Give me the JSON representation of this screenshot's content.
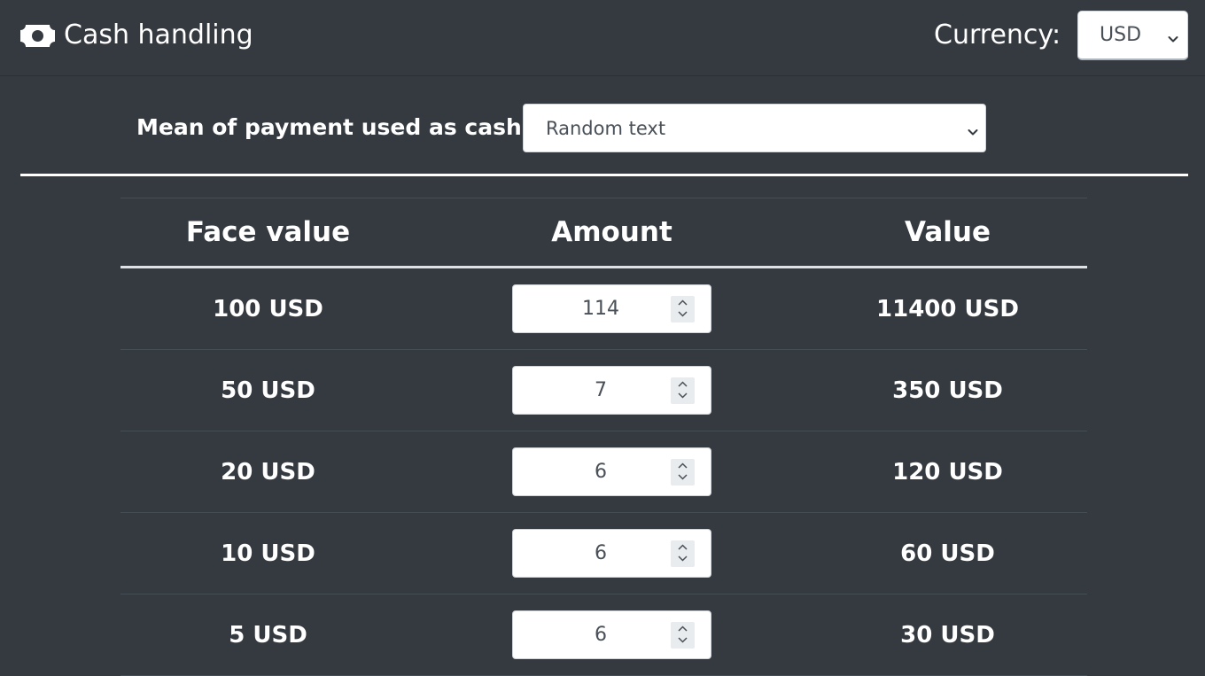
{
  "header": {
    "title": "Cash handling",
    "icon": "money-bill-icon",
    "currency_label": "Currency:",
    "currency_selected": "USD"
  },
  "payment": {
    "label": "Mean of payment used as cash:",
    "selected": "Random text"
  },
  "table": {
    "columns": [
      "Face value",
      "Amount",
      "Value"
    ],
    "rows": [
      {
        "face_value": "100 USD",
        "amount": "114",
        "value": "11400 USD"
      },
      {
        "face_value": "50 USD",
        "amount": "7",
        "value": "350 USD"
      },
      {
        "face_value": "20 USD",
        "amount": "6",
        "value": "120 USD"
      },
      {
        "face_value": "10 USD",
        "amount": "6",
        "value": "60 USD"
      },
      {
        "face_value": "5 USD",
        "amount": "6",
        "value": "30 USD"
      }
    ]
  },
  "colors": {
    "background": "#343a40",
    "text": "#ffffff",
    "input_bg": "#ffffff",
    "input_text": "#495057"
  }
}
